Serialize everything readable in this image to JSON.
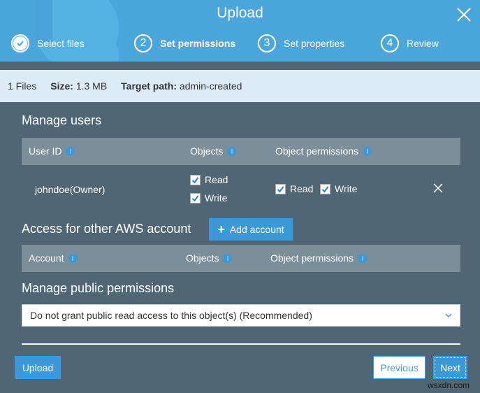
{
  "dialog": {
    "title": "Upload",
    "close_icon": "close-icon"
  },
  "steps": [
    {
      "number": "",
      "label": "Select files",
      "state": "done",
      "icon": "check-circle-icon"
    },
    {
      "number": "2",
      "label": "Set permissions",
      "state": "active"
    },
    {
      "number": "3",
      "label": "Set properties",
      "state": "pending"
    },
    {
      "number": "4",
      "label": "Review",
      "state": "pending"
    }
  ],
  "summary": {
    "files": "1 Files",
    "size_label": "Size:",
    "size_value": "1.3 MB",
    "path_label": "Target path:",
    "path_value": "admin-created"
  },
  "manage_users": {
    "title": "Manage users",
    "columns": [
      "User ID",
      "Objects",
      "Object permissions"
    ],
    "rows": [
      {
        "user_id": "johndoe(Owner)",
        "objects": [
          {
            "label": "Read",
            "checked": true
          },
          {
            "label": "Write",
            "checked": true
          }
        ],
        "object_permissions": [
          {
            "label": "Read",
            "checked": true
          },
          {
            "label": "Write",
            "checked": true
          }
        ]
      }
    ]
  },
  "other_accounts": {
    "title": "Access for other AWS account",
    "add_button": "Add account",
    "columns": [
      "Account",
      "Objects",
      "Object permissions"
    ]
  },
  "public_permissions": {
    "title": "Manage public permissions",
    "selected": "Do not grant public read access to this object(s) (Recommended)"
  },
  "footer": {
    "upload": "Upload",
    "previous": "Previous",
    "next": "Next"
  },
  "watermark": "wsxdn.com",
  "colors": {
    "header": "#4ba6dc",
    "body": "#506675",
    "accent": "#3a9ad9",
    "info_bar": "#dcecf7",
    "table_header": "#7b8f9b"
  }
}
